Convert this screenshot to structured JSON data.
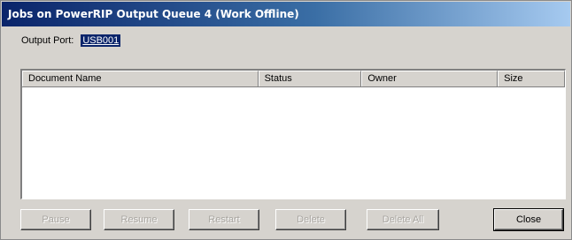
{
  "window": {
    "title": "Jobs on PowerRIP Output Queue 4 (Work Offline)"
  },
  "output_port": {
    "label": "Output Port:",
    "value": "USB001"
  },
  "jobs_list": {
    "columns": [
      "Document Name",
      "Status",
      "Owner",
      "Size"
    ],
    "rows": []
  },
  "buttons": {
    "pause": "Pause",
    "resume": "Resume",
    "restart": "Restart",
    "delete": "Delete",
    "delete_all": "Delete All",
    "close": "Close"
  },
  "colors": {
    "title_bar_start": "#0a246a",
    "title_bar_end": "#a6caf0",
    "dialog_face": "#d6d3ce",
    "selection": "#0a246a",
    "disabled_text": "#a8a5a0"
  }
}
